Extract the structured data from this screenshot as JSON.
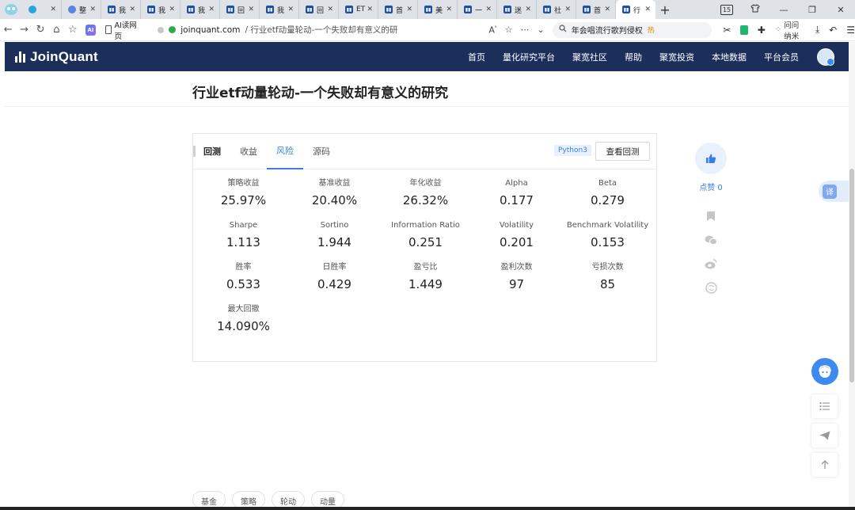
{
  "browser": {
    "tabs": [
      {
        "icon": "telegram-icon",
        "label": "",
        "kind": "tg"
      },
      {
        "icon": "vk-icon",
        "label": "整",
        "kind": "vk"
      },
      {
        "icon": "joinquant-favicon",
        "label": "我",
        "kind": "jq"
      },
      {
        "icon": "joinquant-favicon",
        "label": "我",
        "kind": "jq"
      },
      {
        "icon": "joinquant-favicon",
        "label": "我",
        "kind": "jq"
      },
      {
        "icon": "joinquant-favicon",
        "label": "回",
        "kind": "jq"
      },
      {
        "icon": "joinquant-favicon",
        "label": "我",
        "kind": "jq"
      },
      {
        "icon": "joinquant-favicon",
        "label": "回",
        "kind": "jq"
      },
      {
        "icon": "joinquant-favicon",
        "label": "ET",
        "kind": "jq"
      },
      {
        "icon": "joinquant-favicon",
        "label": "首",
        "kind": "jq"
      },
      {
        "icon": "joinquant-favicon",
        "label": "美",
        "kind": "jq"
      },
      {
        "icon": "joinquant-favicon",
        "label": "一",
        "kind": "jq"
      },
      {
        "icon": "joinquant-favicon",
        "label": "迷",
        "kind": "jq"
      },
      {
        "icon": "joinquant-favicon",
        "label": "社",
        "kind": "jq"
      },
      {
        "icon": "joinquant-favicon",
        "label": "首",
        "kind": "jq"
      },
      {
        "icon": "joinquant-favicon",
        "label": "行",
        "kind": "jq",
        "active": true
      }
    ],
    "tab_counter": "15",
    "ai_read_label": "AI读网页",
    "url_domain": "joinquant.com",
    "url_path": " / 行业etf动量轮动-一个失败却有意义的研",
    "search_text": "年会唱流行歌判侵权",
    "search_hot": "热",
    "ask_label": "问问纳米"
  },
  "site": {
    "logo": "JoinQuant",
    "nav": [
      "首页",
      "量化研究平台",
      "聚宽社区",
      "帮助",
      "聚宽投资",
      "本地数据",
      "平台会员"
    ]
  },
  "article": {
    "title": "行业etf动量轮动-一个失败却有意义的研究"
  },
  "backtest": {
    "tabs": [
      "回测",
      "收益",
      "风险",
      "源码"
    ],
    "active_tab": "风险",
    "language_tag": "Python3",
    "view_button": "查看回测",
    "metrics": [
      {
        "label": "策略收益",
        "value": "25.97%"
      },
      {
        "label": "基准收益",
        "value": "20.40%"
      },
      {
        "label": "年化收益",
        "value": "26.32%"
      },
      {
        "label": "Alpha",
        "value": "0.177"
      },
      {
        "label": "Beta",
        "value": "0.279"
      },
      {
        "label": "Sharpe",
        "value": "1.113"
      },
      {
        "label": "Sortino",
        "value": "1.944"
      },
      {
        "label": "Information Ratio",
        "value": "0.251"
      },
      {
        "label": "Volatility",
        "value": "0.201"
      },
      {
        "label": "Benchmark Volatility",
        "value": "0.153"
      },
      {
        "label": "胜率",
        "value": "0.533"
      },
      {
        "label": "日胜率",
        "value": "0.429"
      },
      {
        "label": "盈亏比",
        "value": "1.449"
      },
      {
        "label": "盈利次数",
        "value": "97"
      },
      {
        "label": "亏损次数",
        "value": "85"
      },
      {
        "label": "最大回撤",
        "value": "14.090%"
      }
    ]
  },
  "side": {
    "like_label": "点赞 0",
    "translate_label": "译"
  },
  "tags": [
    "基金",
    "策略",
    "轮动",
    "动量"
  ],
  "colors": {
    "header_bg": "#1c2f5a",
    "accent": "#3a7ee4"
  }
}
